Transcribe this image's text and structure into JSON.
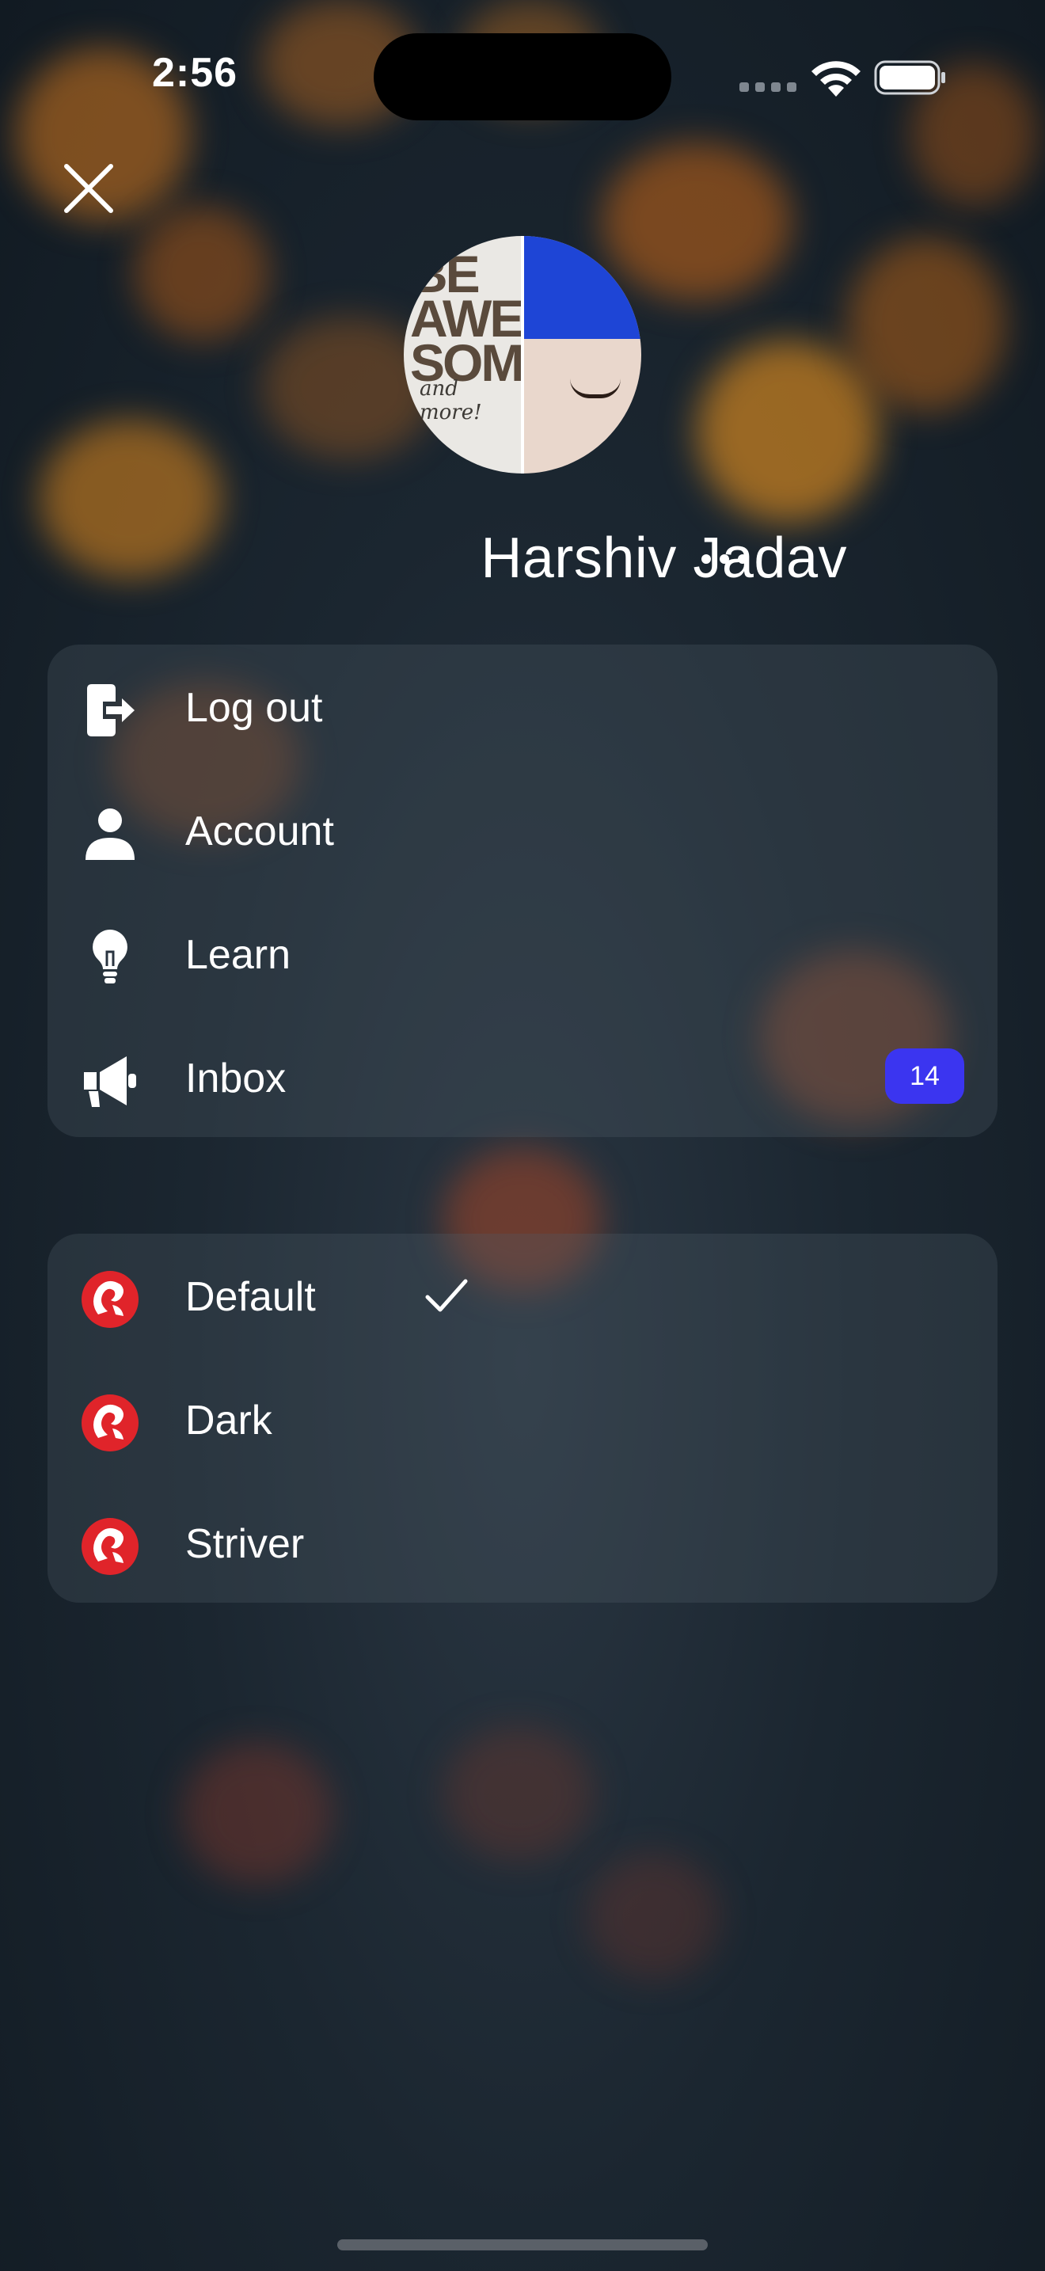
{
  "status_bar": {
    "time": "2:56",
    "icons": [
      "cellular-signal-icon",
      "wifi-icon",
      "battery-icon"
    ]
  },
  "header": {
    "close_icon": "close-icon",
    "avatar_text_left": "BE AWE SOME",
    "avatar_text_small": "and more!",
    "profile_name": "Harshiv Jadav",
    "more_icon": "ellipsis-icon"
  },
  "menu": {
    "items": [
      {
        "label": "Log out",
        "icon": "logout-icon"
      },
      {
        "label": "Account",
        "icon": "person-icon"
      },
      {
        "label": "Learn",
        "icon": "lightbulb-icon"
      },
      {
        "label": "Inbox",
        "icon": "megaphone-icon",
        "badge": "14"
      }
    ]
  },
  "themes": {
    "items": [
      {
        "label": "Default",
        "icon": "app-logo-icon",
        "selected": true
      },
      {
        "label": "Dark",
        "icon": "app-logo-icon",
        "selected": false
      },
      {
        "label": "Striver",
        "icon": "app-logo-icon",
        "selected": false
      }
    ]
  },
  "colors": {
    "badge": "#3b35f0",
    "logo_red": "#e0242a",
    "card_bg": "rgba(80,92,104,0.30)"
  }
}
